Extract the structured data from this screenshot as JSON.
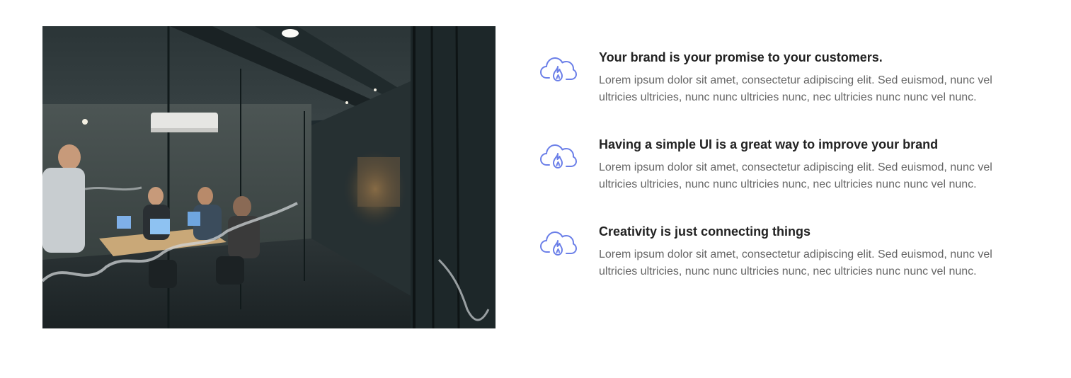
{
  "image": {
    "icon": "office-meeting-photo"
  },
  "features": [
    {
      "icon": "cloud-flame-icon",
      "title": "Your brand is your promise to your customers.",
      "text": "Lorem ipsum dolor sit amet, consectetur adipiscing elit. Sed euismod, nunc vel ultricies ultricies, nunc nunc ultricies nunc, nec ultricies nunc nunc vel nunc."
    },
    {
      "icon": "cloud-flame-icon",
      "title": "Having a simple UI is a great way to improve your brand",
      "text": "Lorem ipsum dolor sit amet, consectetur adipiscing elit. Sed euismod, nunc vel ultricies ultricies, nunc nunc ultricies nunc, nec ultricies nunc nunc vel nunc."
    },
    {
      "icon": "cloud-flame-icon",
      "title": "Creativity is just connecting things",
      "text": "Lorem ipsum dolor sit amet, consectetur adipiscing elit. Sed euismod, nunc vel ultricies ultricies, nunc nunc ultricies nunc, nec ultricies nunc nunc vel nunc."
    }
  ],
  "colors": {
    "accent": "#6b7fe8",
    "title": "#222222",
    "text": "#666666"
  }
}
